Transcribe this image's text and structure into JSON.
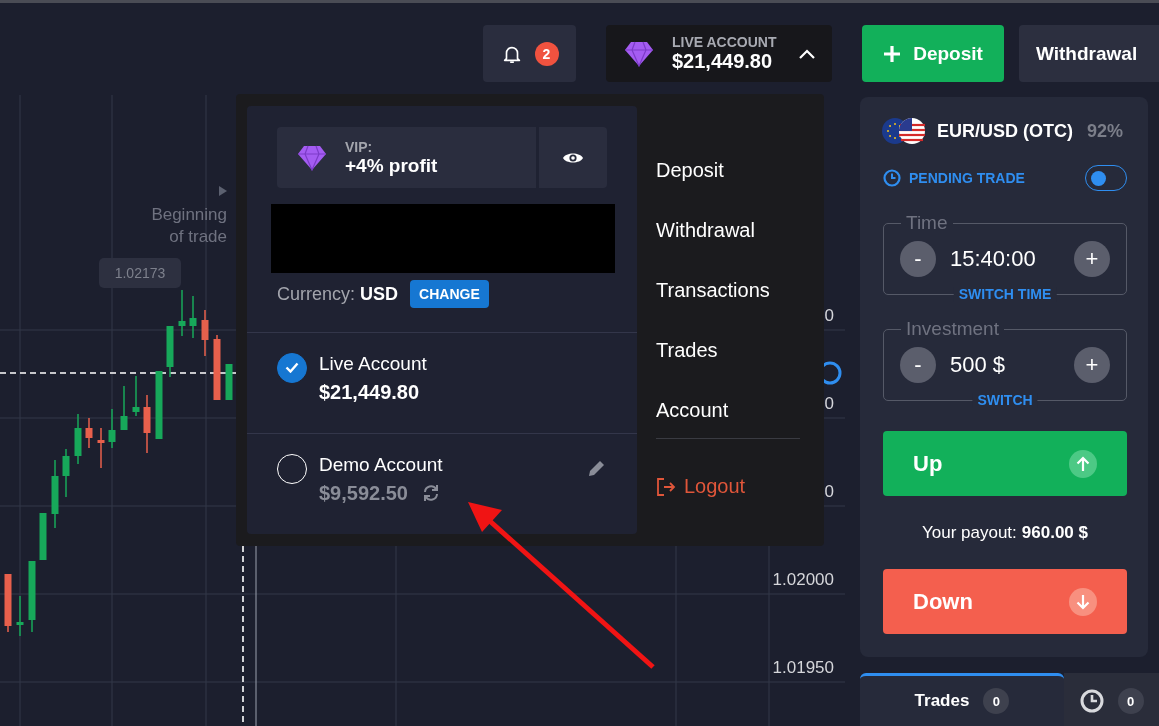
{
  "top_bar": {
    "notifications": {
      "count": "2"
    },
    "account": {
      "label": "LIVE ACCOUNT",
      "balance": "$21,449.80",
      "expanded": true
    },
    "deposit": "Deposit",
    "withdrawal": "Withdrawal"
  },
  "chart": {
    "marker_label": [
      "Beginning",
      "of trade"
    ],
    "tooltip": "1.02173",
    "price_labels": [
      "0",
      "0",
      "0",
      "1.02000",
      "1.01950"
    ]
  },
  "account_menu": {
    "vip_label": "VIP:",
    "vip_value": "+4% profit",
    "currency_label": "Currency:",
    "currency": "USD",
    "change": "CHANGE",
    "accounts": [
      {
        "kind": "live",
        "name": "Live Account",
        "balance": "$21,449.80",
        "selected": true
      },
      {
        "kind": "demo",
        "name": "Demo Account",
        "balance": "$9,592.50",
        "selected": false
      }
    ],
    "links": [
      "Deposit",
      "Withdrawal",
      "Transactions",
      "Trades",
      "Account"
    ],
    "logout": "Logout"
  },
  "trade_panel": {
    "pair": "EUR/USD (OTC)",
    "payout_pct": "92%",
    "pending": {
      "label": "PENDING TRADE",
      "on": false
    },
    "fields": [
      {
        "legend": "Time",
        "value": "15:40:00",
        "minus": "-",
        "plus": "+",
        "switch": "SWITCH TIME"
      },
      {
        "legend": "Investment",
        "value": "500 $",
        "minus": "-",
        "plus": "+",
        "switch": "SWITCH"
      }
    ],
    "up": "Up",
    "payout_label": "Your payout:",
    "payout_value": "960.00 $",
    "down": "Down"
  },
  "bottom_tabs": [
    {
      "kind": "text",
      "label": "Trades",
      "count": "0",
      "selected": true
    },
    {
      "kind": "icon",
      "count": "0",
      "selected": false
    }
  ]
}
